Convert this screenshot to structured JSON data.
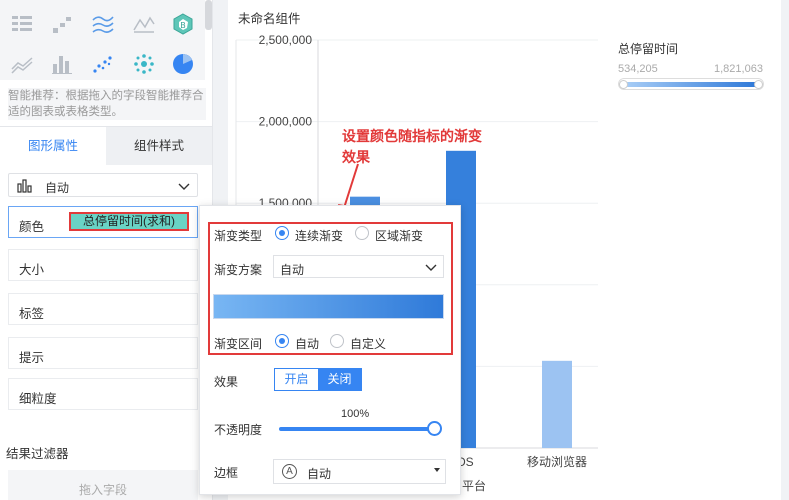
{
  "left_panel": {
    "chart_icons": [
      "table-icon",
      "bar-icon",
      "line-icon",
      "area-line-icon",
      "radar-icon",
      "line-area-icon",
      "column-icon",
      "scatter-icon",
      "dot-cluster-icon",
      "pie-icon"
    ],
    "hint_text": "智能推荐：根据拖入的字段智能推荐合适的图表或表格类型。",
    "tabs": {
      "active": "图形属性",
      "inactive": "组件样式"
    },
    "chart_type_value": "自动",
    "color_label": "颜色",
    "color_field": "总停留时间(求和)",
    "size_label": "大小",
    "label_label": "标签",
    "tooltip_label": "提示",
    "granularity_label": "细粒度",
    "filter_title": "结果过滤器",
    "drop_placeholder": "拖入字段"
  },
  "canvas": {
    "title": "未命名组件",
    "legend": {
      "title": "总停留时间",
      "min": "534,205",
      "max": "1,821,063"
    }
  },
  "chart_data": {
    "type": "bar",
    "categories": [
      "",
      "iOS",
      "移动浏览器"
    ],
    "values": [
      1540000,
      1821063,
      534205
    ],
    "ylim": [
      0,
      2500000
    ],
    "yticks": [
      "2,500,000",
      "2,000,000",
      "1,500,000"
    ],
    "xlabel_partial": "平台",
    "xtick_partial": "OS",
    "colors": {
      "low": "#9cc3f2",
      "high": "#3580dc"
    }
  },
  "popup": {
    "gradient_type_label": "渐变类型",
    "gradient_type_options": [
      "连续渐变",
      "区域渐变"
    ],
    "gradient_type_selected": "连续渐变",
    "scheme_label": "渐变方案",
    "scheme_value": "自动",
    "range_label": "渐变区间",
    "range_options": [
      "自动",
      "自定义"
    ],
    "range_selected": "自动",
    "effect_label": "效果",
    "effect_on": "开启",
    "effect_off": "关闭",
    "effect_selected": "关闭",
    "opacity_label": "不透明度",
    "opacity_value": "100%",
    "opacity_fraction": 1.0,
    "border_label": "边框",
    "border_value": "自动"
  },
  "annotation": {
    "text": "设置颜色随指标的渐变效果"
  },
  "colors": {
    "accent": "#3685f2",
    "highlight": "#e23a3a",
    "chip": "#69d3c5"
  }
}
